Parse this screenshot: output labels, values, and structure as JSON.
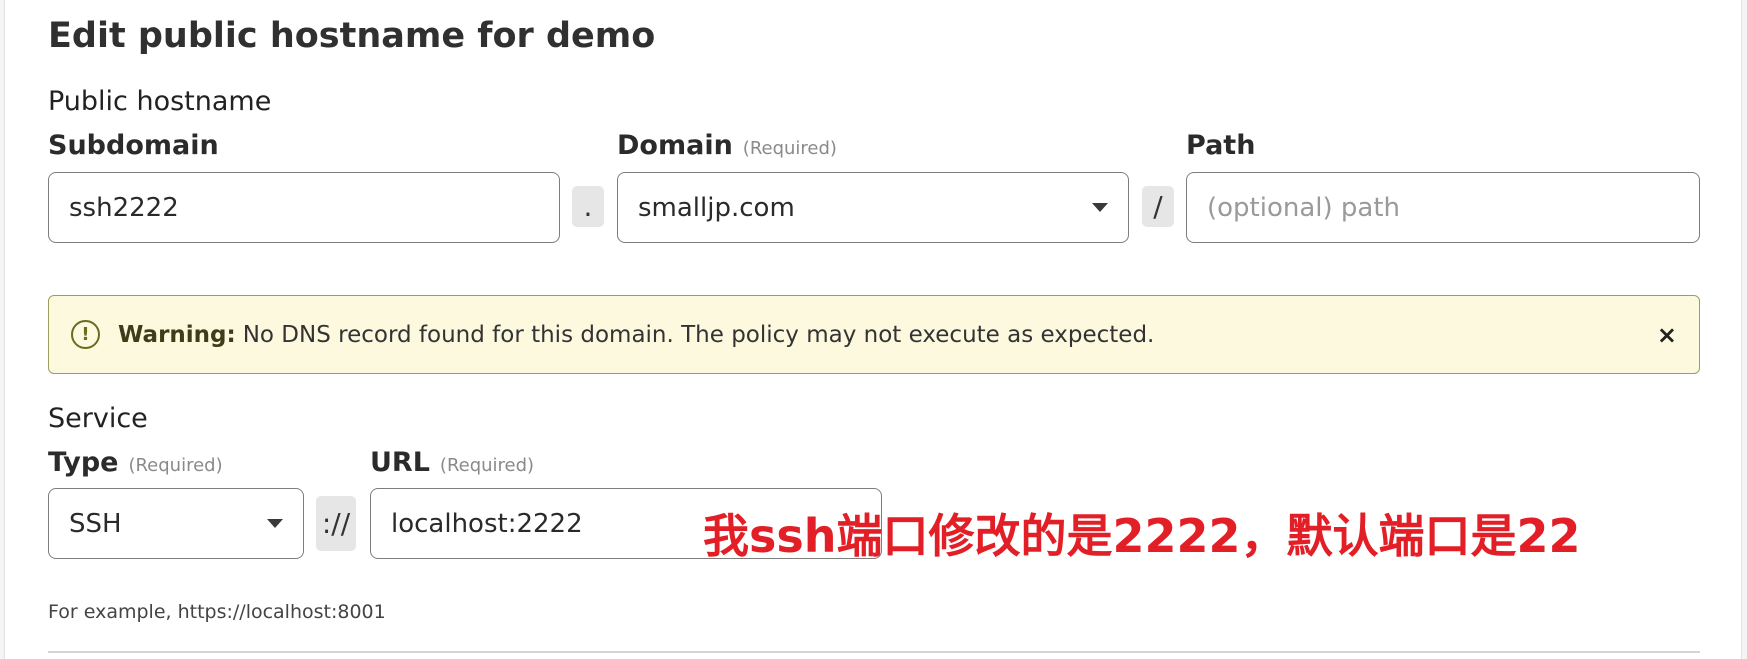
{
  "page": {
    "title": "Edit public hostname for demo"
  },
  "public_hostname": {
    "section_label": "Public hostname",
    "subdomain": {
      "label": "Subdomain",
      "value": "ssh2222"
    },
    "dot_separator": ".",
    "domain": {
      "label": "Domain",
      "required": "(Required)",
      "value": "smalljp.com"
    },
    "slash_separator": "/",
    "path": {
      "label": "Path",
      "placeholder": "(optional) path",
      "value": ""
    }
  },
  "warning": {
    "icon": "exclamation-circle-icon",
    "icon_glyph": "!",
    "strong": "Warning:",
    "message": "No DNS record found for this domain. The policy may not execute as expected.",
    "close_glyph": "×"
  },
  "service": {
    "section_label": "Service",
    "type": {
      "label": "Type",
      "required": "(Required)",
      "value": "SSH"
    },
    "scheme_separator": "://",
    "url": {
      "label": "URL",
      "required": "(Required)",
      "value": "localhost:2222"
    },
    "hint": "For example, https://localhost:8001"
  },
  "annotation": {
    "text": "我ssh端口修改的是2222，默认端口是22",
    "color": "#e21f26"
  },
  "colors": {
    "warning_bg": "#fcf9df",
    "warning_border": "#9aa05c"
  }
}
